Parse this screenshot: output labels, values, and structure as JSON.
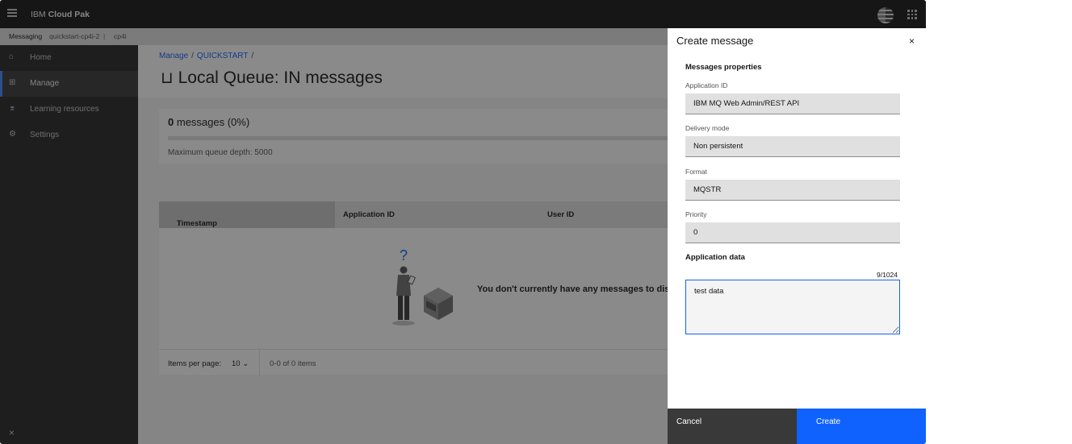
{
  "topbar": {
    "brand_prefix": "IBM",
    "brand_name": "Cloud Pak"
  },
  "subbar": {
    "title": "Messaging",
    "instance": "quickstart-cp4i-2",
    "separator": "|",
    "namespace": "cp4i"
  },
  "sidebar": {
    "items": [
      {
        "label": "Home",
        "icon": "home-icon"
      },
      {
        "label": "Manage",
        "icon": "grid-icon",
        "active": true
      },
      {
        "label": "Learning resources",
        "icon": "learning-icon"
      },
      {
        "label": "Settings",
        "icon": "gear-icon"
      }
    ],
    "close": "×"
  },
  "breadcrumb": {
    "items": [
      "Manage",
      "QUICKSTART"
    ],
    "separator": "/"
  },
  "page": {
    "title": "Local Queue: IN messages",
    "icon": "queue-icon"
  },
  "depth_card": {
    "count": "0",
    "count_suffix": "messages (0%)",
    "max_depth": "Maximum queue depth: 5000"
  },
  "table": {
    "columns": [
      "Timestamp",
      "Application ID",
      "User ID"
    ],
    "sort_indicator": "↓",
    "empty_text": "You don't currently have any messages to displa",
    "pager": {
      "items_per_page_label": "Items per page:",
      "items_per_page": "10",
      "range": "0-0 of 0 items"
    }
  },
  "panel": {
    "title": "Create message",
    "close": "×",
    "properties_heading": "Messages properties",
    "fields": [
      {
        "label": "Application ID",
        "value": "IBM MQ Web Admin/REST API"
      },
      {
        "label": "Delivery mode",
        "value": "Non persistent"
      },
      {
        "label": "Format",
        "value": "MQSTR"
      },
      {
        "label": "Priority",
        "value": "0"
      }
    ],
    "app_data_heading": "Application data",
    "app_data_counter": "9/1024",
    "app_data_value": "test data",
    "cancel_label": "Cancel",
    "create_label": "Create"
  },
  "colors": {
    "accent": "#0f62fe",
    "topbar": "#161616",
    "sidebar": "#262626"
  }
}
